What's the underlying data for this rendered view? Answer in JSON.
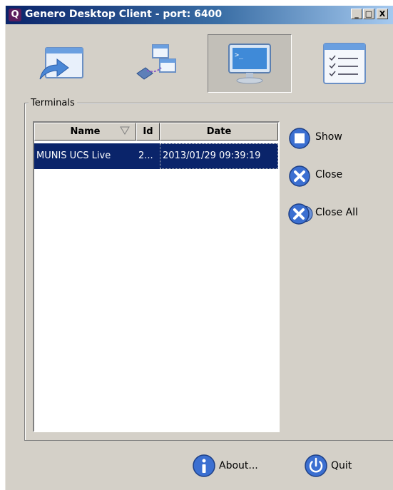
{
  "window": {
    "title": "Genero Desktop Client - port: 6400",
    "icon": "genero-q-icon"
  },
  "window_controls": {
    "minimize": "_",
    "maximize": "□",
    "close": "X"
  },
  "toolbar": {
    "tools": [
      {
        "name": "shortcut-tool",
        "icon": "window-arrow-icon",
        "active": false
      },
      {
        "name": "connections-tool",
        "icon": "network-windows-icon",
        "active": false
      },
      {
        "name": "terminals-tool",
        "icon": "monitor-terminal-icon",
        "active": true
      },
      {
        "name": "list-tool",
        "icon": "checklist-icon",
        "active": false
      }
    ]
  },
  "group": {
    "label": "Terminals"
  },
  "table": {
    "columns": [
      "Name",
      "Id",
      "Date"
    ],
    "rows": [
      {
        "name": "MUNIS UCS Live",
        "id": "2...",
        "date": "2013/01/29 09:39:19",
        "selected": true
      }
    ]
  },
  "actions": {
    "show": "Show",
    "close": "Close",
    "close_all": "Close All"
  },
  "footer": {
    "about": "About...",
    "quit": "Quit"
  },
  "colors": {
    "selection": "#0a246a",
    "face": "#d4d0c8",
    "button_blue": "#3b6fd1"
  }
}
